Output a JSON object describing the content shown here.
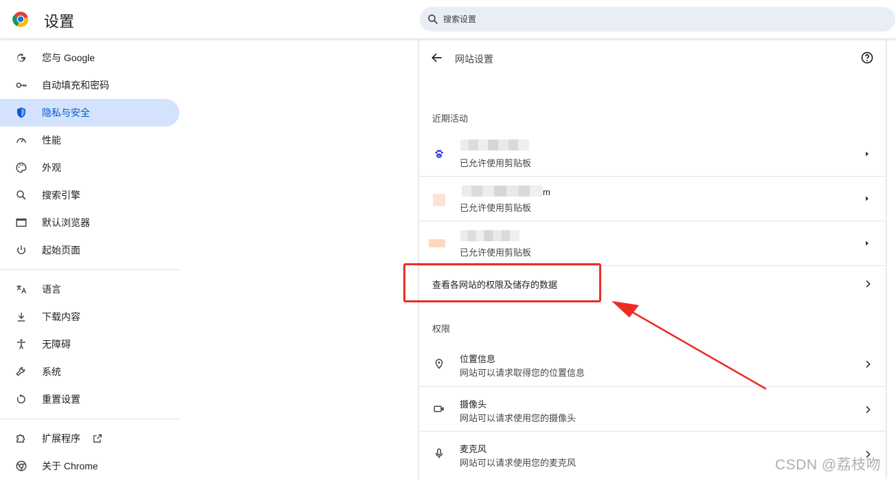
{
  "header": {
    "app_title": "设置",
    "search_placeholder": "搜索设置"
  },
  "sidebar": {
    "items": [
      {
        "label": "您与 Google",
        "icon": "google-g-icon"
      },
      {
        "label": "自动填充和密码",
        "icon": "key-icon"
      },
      {
        "label": "隐私与安全",
        "icon": "shield-icon",
        "active": true
      },
      {
        "label": "性能",
        "icon": "speedometer-icon"
      },
      {
        "label": "外观",
        "icon": "palette-icon"
      },
      {
        "label": "搜索引擎",
        "icon": "search-icon"
      },
      {
        "label": "默认浏览器",
        "icon": "browser-window-icon"
      },
      {
        "label": "起始页面",
        "icon": "power-icon"
      },
      {
        "label": "语言",
        "icon": "translate-icon"
      },
      {
        "label": "下载内容",
        "icon": "download-icon"
      },
      {
        "label": "无障碍",
        "icon": "accessibility-icon"
      },
      {
        "label": "系统",
        "icon": "wrench-icon"
      },
      {
        "label": "重置设置",
        "icon": "reset-icon"
      },
      {
        "label": "扩展程序",
        "icon": "puzzle-icon"
      },
      {
        "label": "关于 Chrome",
        "icon": "chrome-icon"
      }
    ]
  },
  "main": {
    "title": "网站设置",
    "recent_title": "近期活动",
    "recent": [
      {
        "site_suffix": "",
        "status": "已允许使用剪贴板",
        "icon": "baidu-paw-icon"
      },
      {
        "site_suffix": "m",
        "status": "已允许使用剪贴板",
        "icon": "site-favicon"
      },
      {
        "site_suffix": "",
        "status": "已允许使用剪贴板",
        "icon": "site-favicon"
      }
    ],
    "view_all_label": "查看各网站的权限及储存的数据",
    "permissions_title": "权限",
    "permissions": [
      {
        "title": "位置信息",
        "desc": "网站可以请求取得您的位置信息",
        "icon": "location-pin-icon"
      },
      {
        "title": "摄像头",
        "desc": "网站可以请求使用您的摄像头",
        "icon": "camera-icon"
      },
      {
        "title": "麦克风",
        "desc": "网站可以请求使用您的麦克风",
        "icon": "microphone-icon"
      }
    ]
  },
  "colors": {
    "accent": "#0b57d0",
    "active_bg": "#d3e3fd",
    "annotation": "#ee2b24"
  },
  "watermark": "CSDN @荔枝吻"
}
